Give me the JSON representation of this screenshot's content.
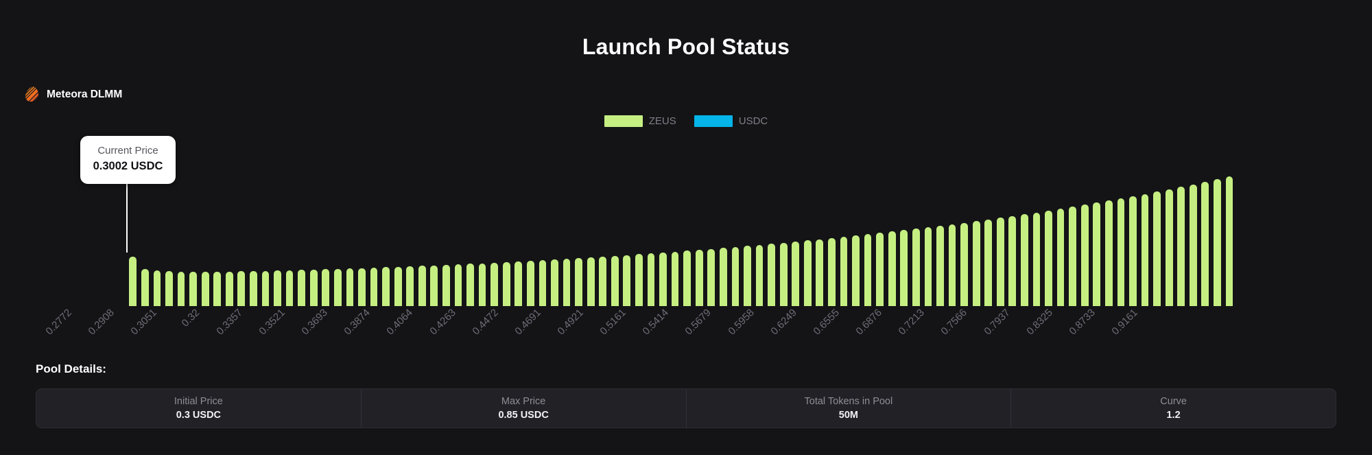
{
  "header": {
    "title": "Launch Pool Status"
  },
  "brand": {
    "label": "Meteora DLMM",
    "icon": "meteora-logo-icon",
    "color_start": "#f47b20",
    "color_end": "#c0392b"
  },
  "legend": {
    "items": [
      {
        "label": "ZEUS",
        "color": "#c6ef82"
      },
      {
        "label": "USDC",
        "color": "#05b4e8"
      }
    ]
  },
  "tooltip": {
    "title": "Current Price",
    "value": "0.3002 USDC"
  },
  "details": {
    "heading": "Pool Details:",
    "cells": [
      {
        "label": "Initial Price",
        "value": "0.3 USDC"
      },
      {
        "label": "Max Price",
        "value": "0.85 USDC"
      },
      {
        "label": "Total Tokens in Pool",
        "value": "50M"
      },
      {
        "label": "Curve",
        "value": "1.2"
      }
    ]
  },
  "chart_data": {
    "type": "bar",
    "title": "Launch Pool Status",
    "xlabel": "",
    "ylabel": "",
    "grid": false,
    "legend_position": "top-center",
    "tick_labels": [
      "0.2772",
      "0.2908",
      "0.3051",
      "0.32",
      "0.3357",
      "0.3521",
      "0.3693",
      "0.3874",
      "0.4064",
      "0.4263",
      "0.4472",
      "0.4691",
      "0.4921",
      "0.5161",
      "0.5414",
      "0.5679",
      "0.5958",
      "0.6249",
      "0.6555",
      "0.6876",
      "0.7213",
      "0.7566",
      "0.7937",
      "0.8325",
      "0.8733",
      "0.9161"
    ],
    "series": [
      {
        "name": "ZEUS",
        "color": "#c6ef82",
        "values": [
          72,
          54,
          52,
          51,
          50,
          50,
          50,
          50,
          50,
          51,
          51,
          51,
          52,
          52,
          53,
          53,
          54,
          54,
          55,
          55,
          56,
          57,
          57,
          58,
          59,
          59,
          60,
          61,
          62,
          62,
          63,
          64,
          65,
          66,
          67,
          68,
          69,
          70,
          71,
          72,
          73,
          74,
          76,
          77,
          78,
          79,
          81,
          82,
          83,
          85,
          86,
          88,
          89,
          91,
          92,
          94,
          96,
          97,
          99,
          101,
          103,
          105,
          107,
          109,
          111,
          113,
          115,
          117,
          119,
          121,
          124,
          126,
          129,
          131,
          134,
          136,
          139,
          142,
          145,
          148,
          151,
          154,
          157,
          160,
          163,
          167,
          170,
          174,
          177,
          181,
          185,
          189
        ]
      },
      {
        "name": "USDC",
        "color": "#05b4e8",
        "values": []
      }
    ],
    "ylim": [
      0,
      200
    ],
    "note": "Liquidity distribution bins across price range; bar heights in px relative to plot baseline"
  }
}
